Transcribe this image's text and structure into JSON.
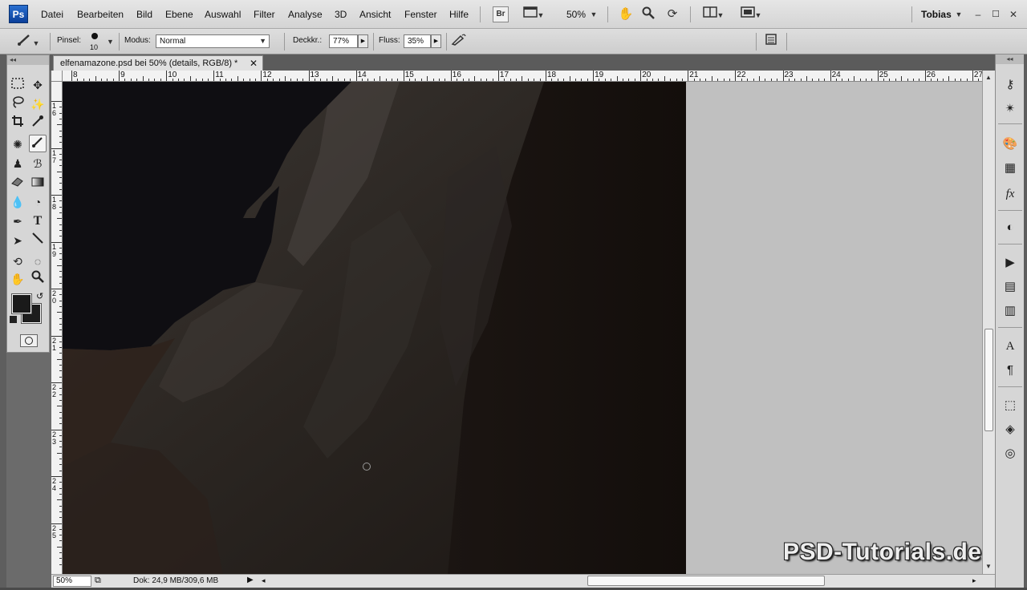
{
  "app": {
    "logo": "Ps"
  },
  "menu": [
    "Datei",
    "Bearbeiten",
    "Bild",
    "Ebene",
    "Auswahl",
    "Filter",
    "Analyse",
    "3D",
    "Ansicht",
    "Fenster",
    "Hilfe"
  ],
  "menubar": {
    "bridge_label": "Br",
    "zoom_value": "50%",
    "user_name": "Tobias"
  },
  "options": {
    "brush_label": "Pinsel:",
    "brush_size": "10",
    "mode_label": "Modus:",
    "mode_value": "Normal",
    "opacity_label": "Deckkr.:",
    "opacity_value": "77%",
    "flow_label": "Fluss:",
    "flow_value": "35%"
  },
  "document": {
    "tab_title": "elfenamazone.psd bei 50% (details, RGB/8) *",
    "close": "✕"
  },
  "ruler_top": [
    "8",
    "9",
    "10",
    "11",
    "12",
    "13",
    "14",
    "15",
    "16",
    "17",
    "18",
    "19",
    "20",
    "21",
    "22",
    "23",
    "24",
    "25",
    "26",
    "27"
  ],
  "ruler_left": [
    "1 6",
    "1 7",
    "1 8",
    "1 9",
    "2 0",
    "2 1",
    "2 2",
    "2 3",
    "2 4",
    "2 5"
  ],
  "status": {
    "zoom": "50%",
    "doc_info": "Dok: 24,9 MB/309,6 MB"
  },
  "watermark": "PSD-Tutorials.de",
  "colors": {
    "foreground": "#1a1a1a",
    "background": "#1d1d1d",
    "canvas_dark": "#120d0a",
    "pasteboard": "#c0c0c0"
  }
}
